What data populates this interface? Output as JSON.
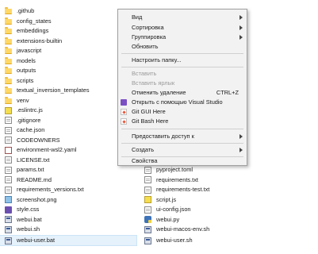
{
  "explorer": {
    "left_items": [
      {
        "label": ".github",
        "icon": "folder-icon"
      },
      {
        "label": "config_states",
        "icon": "folder-icon"
      },
      {
        "label": "embeddings",
        "icon": "folder-icon"
      },
      {
        "label": "extensions-builtin",
        "icon": "folder-icon"
      },
      {
        "label": "javascript",
        "icon": "folder-icon"
      },
      {
        "label": "models",
        "icon": "folder-icon"
      },
      {
        "label": "outputs",
        "icon": "folder-icon"
      },
      {
        "label": "scripts",
        "icon": "folder-icon"
      },
      {
        "label": "textual_inversion_templates",
        "icon": "folder-icon"
      },
      {
        "label": "venv",
        "icon": "folder-icon"
      },
      {
        "label": ".eslintrc.js",
        "icon": "js-file-icon"
      },
      {
        "label": ".gitignore",
        "icon": "text-file-icon"
      },
      {
        "label": "cache.json",
        "icon": "json-file-icon"
      },
      {
        "label": "CODEOWNERS",
        "icon": "text-file-icon"
      },
      {
        "label": "environment-wsl2.yaml",
        "icon": "yaml-file-icon"
      },
      {
        "label": "LICENSE.txt",
        "icon": "text-file-icon"
      },
      {
        "label": "params.txt",
        "icon": "text-file-icon"
      },
      {
        "label": "README.md",
        "icon": "text-file-icon"
      },
      {
        "label": "requirements_versions.txt",
        "icon": "text-file-icon"
      },
      {
        "label": "screenshot.png",
        "icon": "image-file-icon"
      },
      {
        "label": "style.css",
        "icon": "css-file-icon"
      },
      {
        "label": "webui.bat",
        "icon": "batch-file-icon"
      },
      {
        "label": "webui.sh",
        "icon": "batch-file-icon"
      },
      {
        "label": "webui-user.bat",
        "icon": "batch-file-icon"
      }
    ],
    "right_items": [
      {
        "label": "pyproject.toml",
        "icon": "text-file-icon"
      },
      {
        "label": "requirements.txt",
        "icon": "text-file-icon"
      },
      {
        "label": "requirements-test.txt",
        "icon": "text-file-icon"
      },
      {
        "label": "script.js",
        "icon": "js-file-icon"
      },
      {
        "label": "ui-config.json",
        "icon": "json-file-icon"
      },
      {
        "label": "webui.py",
        "icon": "python-file-icon"
      },
      {
        "label": "webui-macos-env.sh",
        "icon": "batch-file-icon"
      },
      {
        "label": "webui-user.sh",
        "icon": "batch-file-icon"
      }
    ]
  },
  "context_menu": {
    "view": "Вид",
    "sort": "Сортировка",
    "group": "Группировка",
    "refresh": "Обновить",
    "customize": "Настроить папку...",
    "paste": "Вставить",
    "paste_shortcut": "Вставить ярлык",
    "undo_delete": "Отменить удаление",
    "undo_shortcut": "CTRL+Z",
    "open_vs": "Открыть с помощью Visual Studio",
    "git_gui": "Git GUI Here",
    "git_bash": "Git Bash Here",
    "share": "Предоставить доступ к",
    "create": "Создать",
    "properties": "Свойства"
  },
  "colors": {
    "menu_background": "#f2f2f2",
    "selection": "#e5f1fb",
    "folder": "#ffd866",
    "disabled_text": "#9a9a9a"
  }
}
